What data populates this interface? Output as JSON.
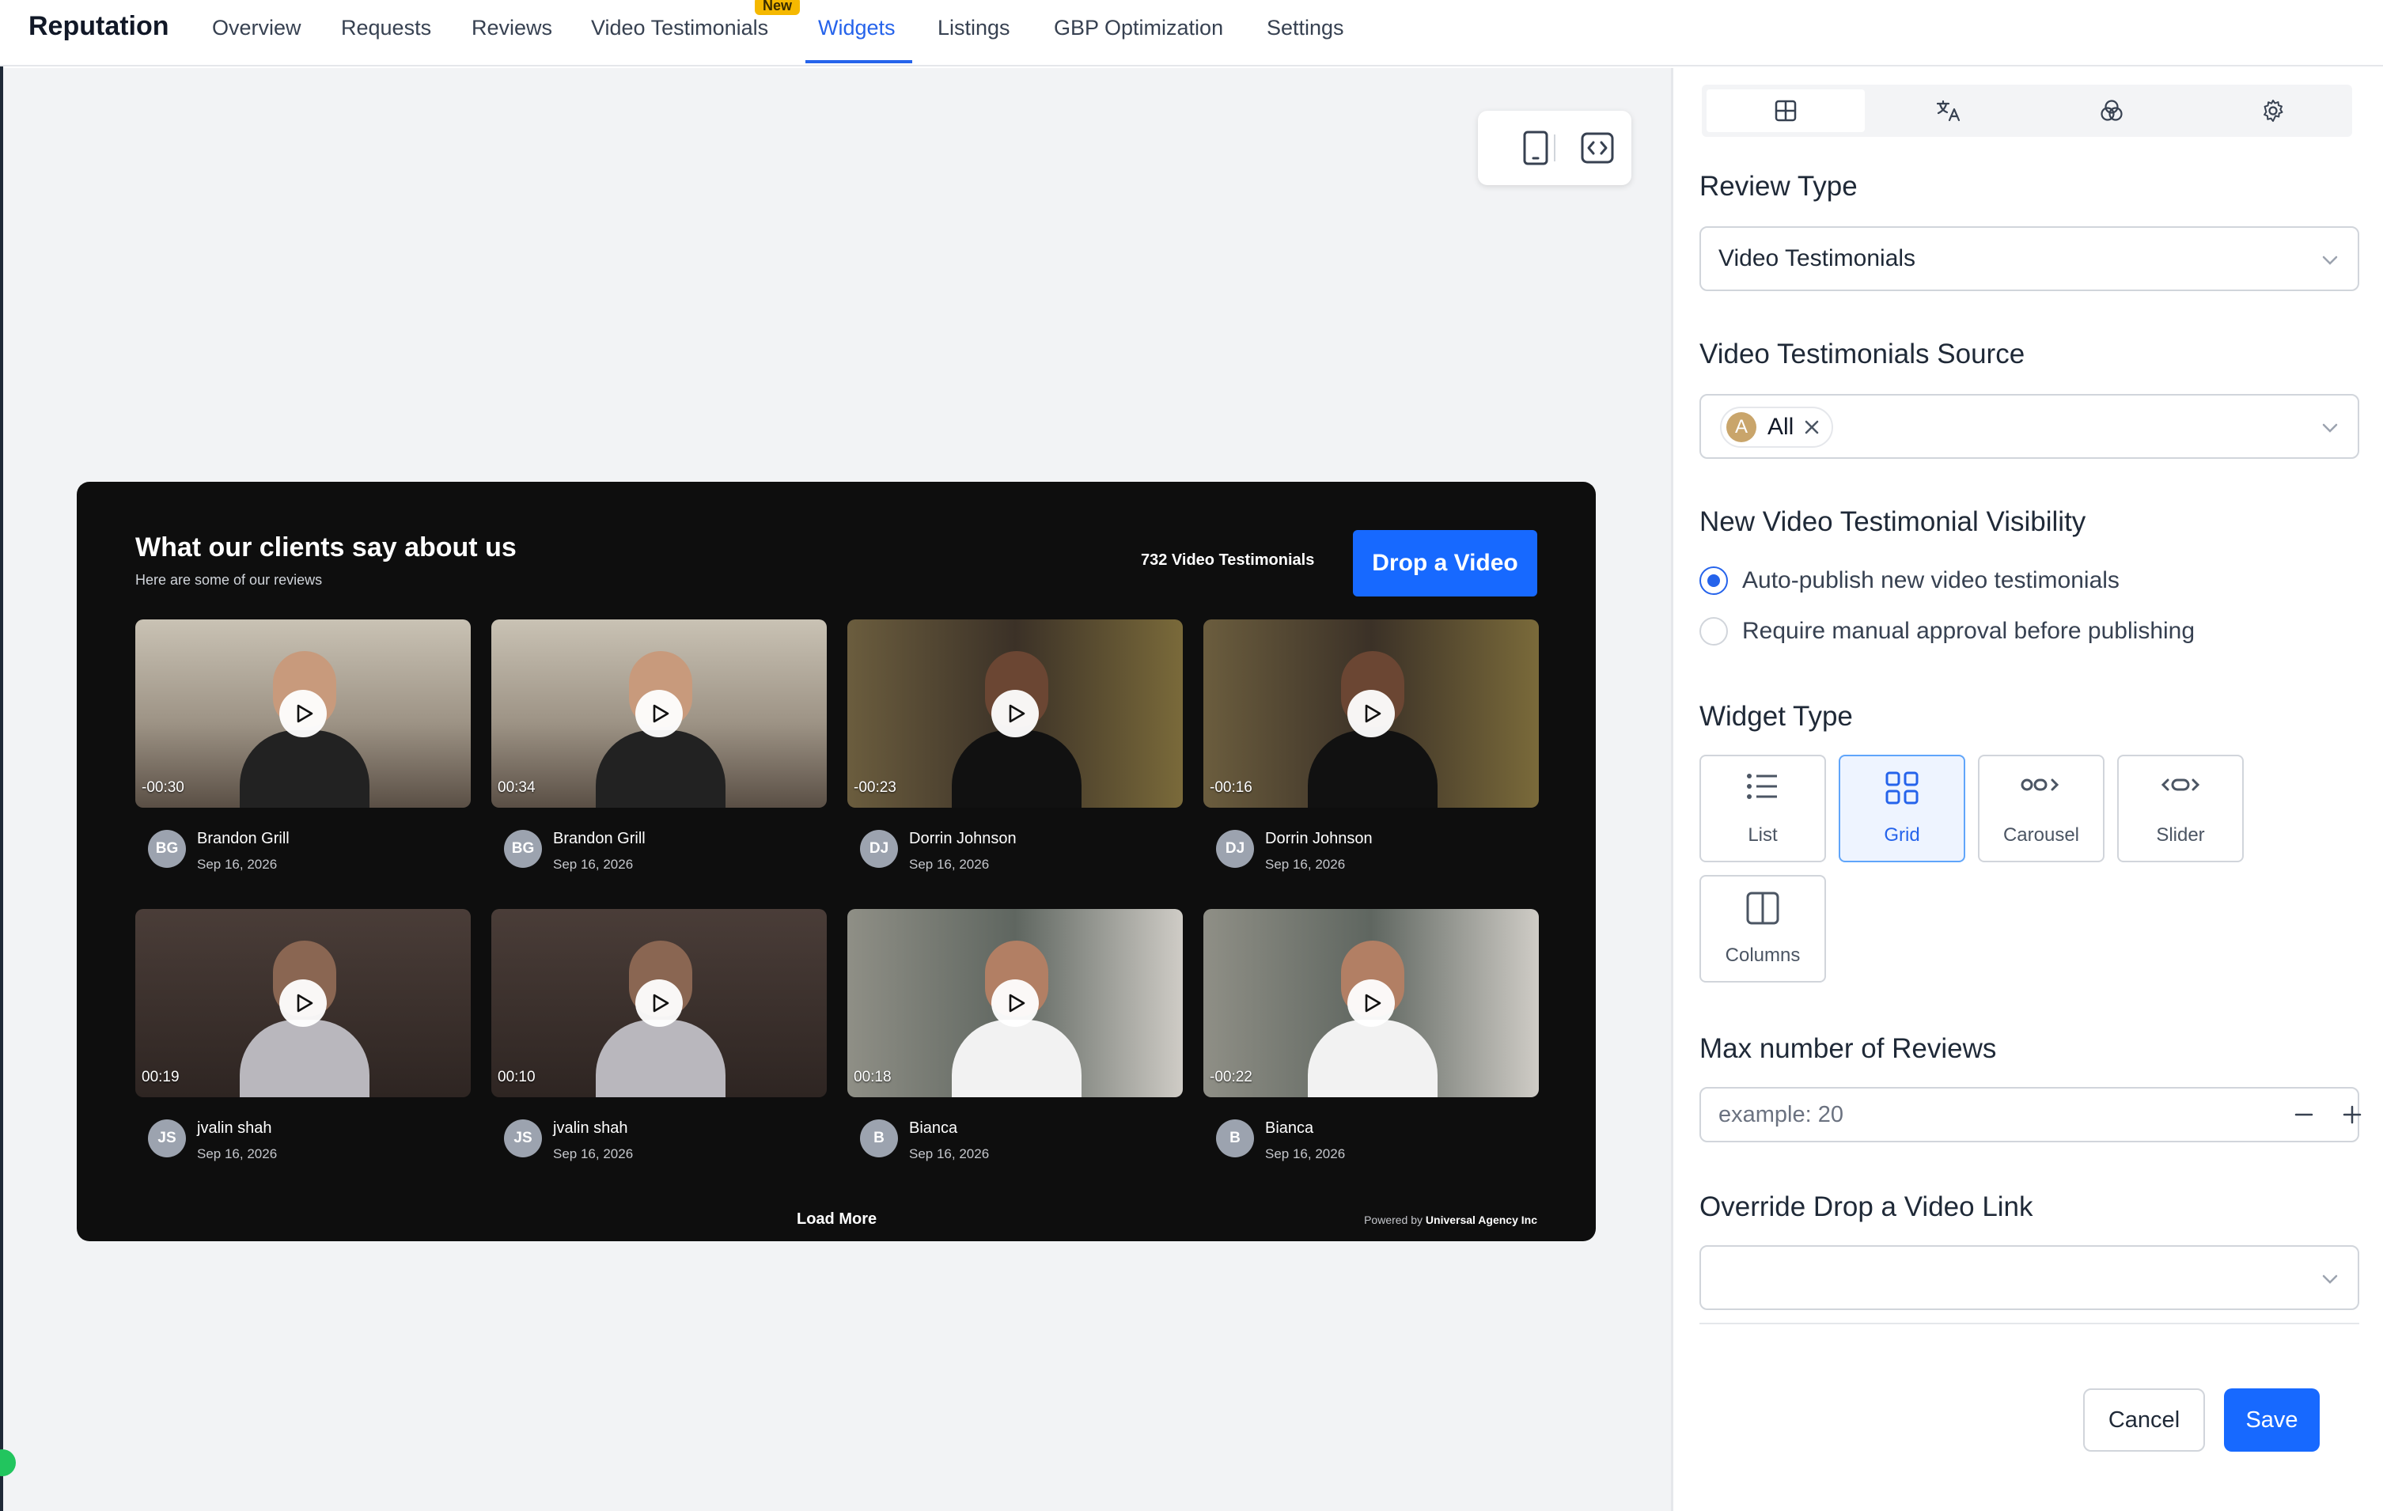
{
  "app": {
    "brand": "Reputation"
  },
  "nav": {
    "items": [
      "Overview",
      "Requests",
      "Reviews",
      "Video Testimonials",
      "Widgets",
      "Listings",
      "GBP Optimization",
      "Settings"
    ],
    "badge": "New",
    "active": "Widgets"
  },
  "widget": {
    "title": "What our clients say about us",
    "subtitle": "Here are some of our reviews",
    "count_text": "732 Video Testimonials",
    "drop_button": "Drop a Video",
    "load_more": "Load More",
    "powered_prefix": "Powered by",
    "powered_brand": "Universal Agency Inc",
    "reviews": [
      {
        "initials": "BG",
        "name": "Brandon Grill",
        "date": "Sep 16, 2026",
        "duration": "-00:30"
      },
      {
        "initials": "BG",
        "name": "Brandon Grill",
        "date": "Sep 16, 2026",
        "duration": "00:34"
      },
      {
        "initials": "DJ",
        "name": "Dorrin Johnson",
        "date": "Sep 16, 2026",
        "duration": "-00:23"
      },
      {
        "initials": "DJ",
        "name": "Dorrin Johnson",
        "date": "Sep 16, 2026",
        "duration": "-00:16"
      },
      {
        "initials": "JS",
        "name": "jvalin shah",
        "date": "Sep 16, 2026",
        "duration": "00:19"
      },
      {
        "initials": "JS",
        "name": "jvalin shah",
        "date": "Sep 16, 2026",
        "duration": "00:10"
      },
      {
        "initials": "B",
        "name": "Bianca",
        "date": "Sep 16, 2026",
        "duration": "00:18"
      },
      {
        "initials": "B",
        "name": "Bianca",
        "date": "Sep 16, 2026",
        "duration": "-00:22"
      }
    ]
  },
  "panel": {
    "review_type": {
      "label": "Review Type",
      "value": "Video Testimonials"
    },
    "source": {
      "label": "Video Testimonials Source",
      "chip_initial": "A",
      "chip_text": "All"
    },
    "visibility": {
      "label": "New Video Testimonial Visibility",
      "options": [
        "Auto-publish new video testimonials",
        "Require manual approval before publishing"
      ],
      "selected": 0
    },
    "widget_type": {
      "label": "Widget Type",
      "options": [
        "List",
        "Grid",
        "Carousel",
        "Slider",
        "Columns"
      ],
      "selected": "Grid"
    },
    "max_reviews": {
      "label": "Max number of Reviews",
      "placeholder": "example: 20"
    },
    "override_link": {
      "label": "Override Drop a Video Link",
      "value": ""
    },
    "cancel": "Cancel",
    "save": "Save"
  },
  "colors": {
    "accent": "#2563eb",
    "button": "#1769ff",
    "badge": "#f5b800",
    "widget_bg": "#0e0e0e"
  }
}
